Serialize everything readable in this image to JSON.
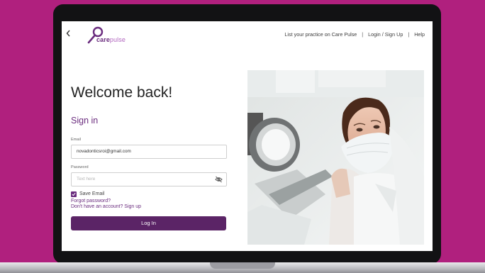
{
  "nav": {
    "back_icon": "chevron-left-icon",
    "logo": {
      "care": "care",
      "pulse": "pulse"
    },
    "links": [
      "List your practice on Care Pulse",
      "Login / Sign Up",
      "Help"
    ],
    "separator": "|"
  },
  "main": {
    "heading": "Welcome back!",
    "subheading": "Sign in",
    "email": {
      "label": "Email",
      "value": "novadonticsroi@gmail.com"
    },
    "password": {
      "label": "Password",
      "placeholder": "Text here",
      "toggle_icon": "eye-off-icon"
    },
    "save_email": {
      "label": "Save Email",
      "checked": true
    },
    "forgot_password": "Forgot password?",
    "no_account": {
      "text": "Don't have an account?",
      "link": "Sign up"
    },
    "login_button": "Log In"
  },
  "colors": {
    "brand": "#6a2c7e",
    "button": "#5b2466",
    "background": "#b0207e"
  }
}
